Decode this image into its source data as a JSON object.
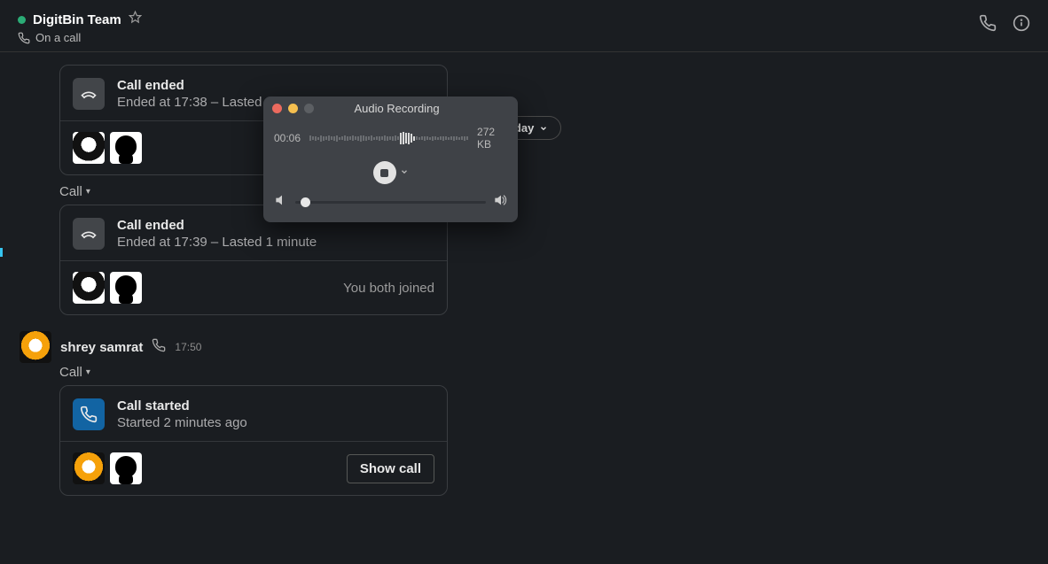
{
  "header": {
    "title": "DigitBin Team",
    "status": "On a call"
  },
  "date_divider": "Today",
  "audio_panel": {
    "title": "Audio Recording",
    "time": "00:06",
    "size": "272 KB"
  },
  "calls": [
    {
      "title": "Call ended",
      "sub": "Ended at 17:38  –  Lasted a few seconds"
    },
    {
      "title": "Call ended",
      "sub": "Ended at 17:39  –  Lasted 1 minute",
      "joined": "You both joined"
    },
    {
      "title": "Call started",
      "sub": "Started 2 minutes ago",
      "show_label": "Show call"
    }
  ],
  "labels": {
    "call": "Call"
  },
  "message": {
    "name": "shrey samrat",
    "time": "17:50"
  }
}
